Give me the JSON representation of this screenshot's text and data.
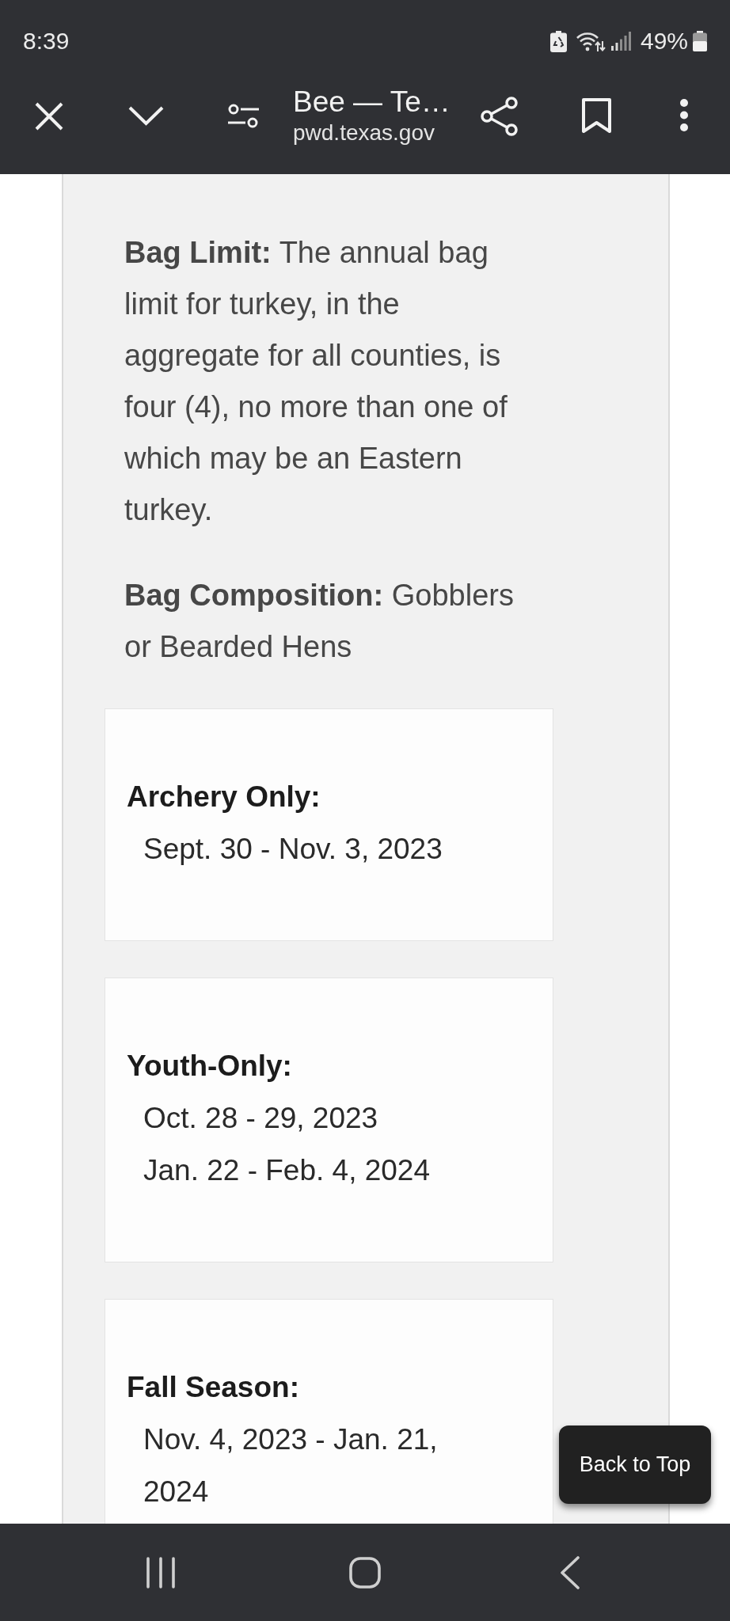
{
  "status_bar": {
    "time": "8:39",
    "battery": "49%"
  },
  "browser_toolbar": {
    "title": "Bee — Te…",
    "url": "pwd.texas.gov"
  },
  "content": {
    "paragraphs": [
      "**Bag Limit:** The annual bag limit for turkey, in the aggregate for all counties, is four (4), no more than one of which may be an Eastern turkey.",
      "**Bag Composition:** Gobblers or Bearded Hens"
    ],
    "season_cards": [
      {
        "title": "Archery Only:",
        "dates": [
          "Sept. 30 - Nov. 3, 2023"
        ]
      },
      {
        "title": "Youth-Only:",
        "dates": [
          "Oct. 28 - 29, 2023",
          "Jan. 22 - Feb. 4, 2024"
        ]
      },
      {
        "title": "Fall Season:",
        "dates": [
          "Nov. 4, 2023 - Jan. 21, 2024"
        ]
      }
    ]
  },
  "back_to_top": {
    "label": "Back to Top"
  }
}
